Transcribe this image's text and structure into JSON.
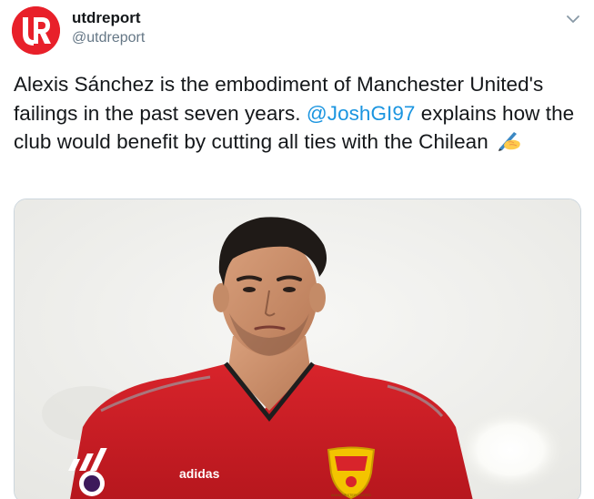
{
  "user": {
    "display_name": "utdreport",
    "handle": "@utdreport",
    "avatar_icon": "utdreport-logo-icon",
    "avatar_color": "#e8202a"
  },
  "menu": {
    "caret_icon": "chevron-down-icon"
  },
  "tweet": {
    "text_part1": "Alexis Sánchez is the embodiment of Manchester United's failings in the past seven years. ",
    "mention": "@JoshGI97",
    "text_part2": " explains how the club would benefit by cutting all ties with the Chilean ",
    "emoji_icon": "writing-hand-icon",
    "mention_color": "#1b95e0"
  },
  "media": {
    "image_icon": "player-photo-image",
    "kit_brand": "adidas",
    "crest_text": "MANCHESTER UNITED"
  }
}
